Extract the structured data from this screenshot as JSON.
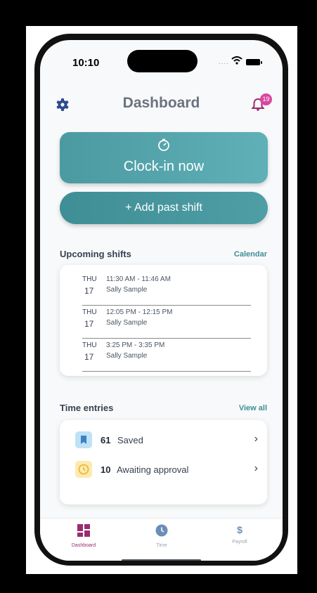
{
  "status": {
    "time": "10:10",
    "signal": "....",
    "wifi_icon": "wifi-icon",
    "battery_icon": "battery-icon"
  },
  "header": {
    "title": "Dashboard",
    "settings_icon": "gear-icon",
    "notifications_icon": "bell-icon",
    "notification_count": "19"
  },
  "actions": {
    "clock_in_label": "Clock-in now",
    "clock_in_icon": "timer-icon",
    "add_past_shift_label": "+ Add past shift"
  },
  "upcoming": {
    "title": "Upcoming shifts",
    "link": "Calendar",
    "shifts": [
      {
        "day": "THU",
        "date": "17",
        "time": "11:30 AM - 11:46 AM",
        "name": "Sally Sample"
      },
      {
        "day": "THU",
        "date": "17",
        "time": "12:05 PM - 12:15 PM",
        "name": "Sally Sample"
      },
      {
        "day": "THU",
        "date": "17",
        "time": "3:25 PM - 3:35 PM",
        "name": "Sally Sample"
      }
    ]
  },
  "time_entries": {
    "title": "Time entries",
    "link": "View all",
    "items": [
      {
        "count": "61",
        "label": "Saved",
        "icon": "bookmark-icon",
        "color": "#bfe2f5",
        "icon_color": "#3b82c4"
      },
      {
        "count": "10",
        "label": "Awaiting approval",
        "icon": "clock-icon",
        "color": "#fdeab0",
        "icon_color": "#e7b93a"
      }
    ]
  },
  "tabbar": {
    "tabs": [
      {
        "label": "Dashboard",
        "icon": "dashboard-icon",
        "active": true
      },
      {
        "label": "Time",
        "icon": "clock-icon",
        "active": false
      },
      {
        "label": "Payroll",
        "icon": "dollar-icon",
        "active": false
      }
    ]
  },
  "colors": {
    "accent": "#4c9aa1",
    "accent_dark": "#3f8e95",
    "active_tab": "#9b2c6f",
    "badge": "#d946a0"
  }
}
